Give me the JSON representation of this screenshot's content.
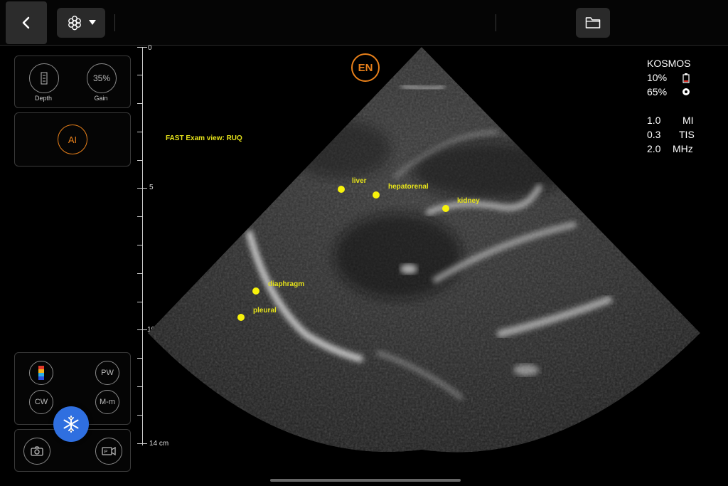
{
  "app": {
    "name": "KOSMOS"
  },
  "toolbar": {
    "back_icon": "chevron-left-icon",
    "probe_icon": "probe-icon",
    "dropdown_icon": "caret-down-icon",
    "folder_icon": "folder-icon"
  },
  "left_panel": {
    "depth_label": "Depth",
    "gain_value": "35%",
    "gain_label": "Gain",
    "ai_label": "AI",
    "modes": {
      "color_icon": "color-doppler-icon",
      "pw": "PW",
      "cw": "CW",
      "mm": "M-m"
    },
    "freeze_icon": "snowflake-icon",
    "camera_icon": "camera-icon",
    "video_icon": "video-icon"
  },
  "accent_colors": {
    "ai_orange": "#e8801a",
    "freeze_blue": "#2f6fe0",
    "annotation_yellow": "#f7f20b"
  },
  "image": {
    "logo": "EN",
    "view_title": "FAST Exam view: RUQ",
    "depth_scale": {
      "top": "0",
      "mid": "5",
      "lower": "10",
      "bottom": "14 cm"
    },
    "annotations": [
      {
        "label": "liver"
      },
      {
        "label": "hepatorenal"
      },
      {
        "label": "kidney"
      },
      {
        "label": "diaphragm"
      },
      {
        "label": "pleural"
      }
    ]
  },
  "status": {
    "device": "KOSMOS",
    "battery": "10%",
    "probe_battery": "65%",
    "mi_value": "1.0",
    "mi_label": "MI",
    "tis_value": "0.3",
    "tis_label": "TIS",
    "freq_value": "2.0",
    "freq_label": "MHz"
  }
}
